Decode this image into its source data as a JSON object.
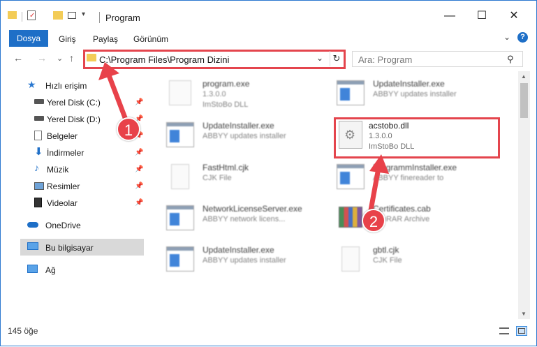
{
  "window": {
    "title": "Program",
    "minimize": "—",
    "maximize": "☐",
    "close": "✕"
  },
  "ribbon": {
    "file_tab": "Dosya",
    "tabs": [
      "Giriş",
      "Paylaş",
      "Görünüm"
    ],
    "expand": "⌄",
    "help": "?"
  },
  "nav": {
    "back": "←",
    "forward": "→",
    "recent": "⌄",
    "up": "↑",
    "address": "C:\\Program Files\\Program Dizini",
    "address_dropdown": "⌄",
    "refresh": "↻",
    "search_placeholder": "Ara: Program",
    "search_icon": "⚲"
  },
  "sidebar": {
    "items": [
      {
        "label": "Hızlı erişim",
        "icon": "star-icon",
        "pinned": false
      },
      {
        "label": "Yerel Disk (C:)",
        "icon": "drive-icon",
        "pinned": true
      },
      {
        "label": "Yerel Disk (D:)",
        "icon": "drive-icon",
        "pinned": true
      },
      {
        "label": "Belgeler",
        "icon": "documents-icon",
        "pinned": true
      },
      {
        "label": "İndirmeler",
        "icon": "downloads-icon",
        "pinned": true
      },
      {
        "label": "Müzik",
        "icon": "music-icon",
        "pinned": true
      },
      {
        "label": "Resimler",
        "icon": "pictures-icon",
        "pinned": true
      },
      {
        "label": "Videolar",
        "icon": "videos-icon",
        "pinned": true
      },
      {
        "label": "OneDrive",
        "icon": "cloud-icon",
        "pinned": false
      },
      {
        "label": "Bu bilgisayar",
        "icon": "computer-icon",
        "pinned": false
      },
      {
        "label": "Ağ",
        "icon": "network-icon",
        "pinned": false
      }
    ]
  },
  "files": [
    {
      "name": "program.exe",
      "sub1": "1.3.0.0",
      "sub2": "ImStoBo DLL",
      "icon": "exe-setup-icon"
    },
    {
      "name": "UpdateInstaller.exe",
      "sub1": "ABBYY updates installer",
      "sub2": "",
      "icon": "app-icon"
    },
    {
      "name": "UpdateInstaller.exe",
      "sub1": "ABBYY updates installer",
      "sub2": "",
      "icon": "app-icon"
    },
    {
      "name": "acstobo.dll",
      "sub1": "1.3.0.0",
      "sub2": "ImStoBo DLL",
      "icon": "dll-gear-icon"
    },
    {
      "name": "FastHtml.cjk",
      "sub1": "CJK File",
      "sub2": "",
      "icon": "document-icon"
    },
    {
      "name": "ProgrammInstaller.exe",
      "sub1": "ABBYY finereader to",
      "sub2": "",
      "icon": "app-icon"
    },
    {
      "name": "NetworkLicenseServer.exe",
      "sub1": "ABBYY network licens...",
      "sub2": "",
      "icon": "app-icon"
    },
    {
      "name": "Certificates.cab",
      "sub1": "WinRAR Archive",
      "sub2": "",
      "icon": "archive-icon"
    },
    {
      "name": "UpdateInstaller.exe",
      "sub1": "ABBYY updates installer",
      "sub2": "",
      "icon": "app-icon"
    },
    {
      "name": "gbtl.cjk",
      "sub1": "CJK File",
      "sub2": "",
      "icon": "document-icon"
    }
  ],
  "annotations": {
    "step1": "1",
    "step2": "2",
    "color": "#e8424a"
  },
  "status": {
    "item_count": "145 öğe"
  }
}
